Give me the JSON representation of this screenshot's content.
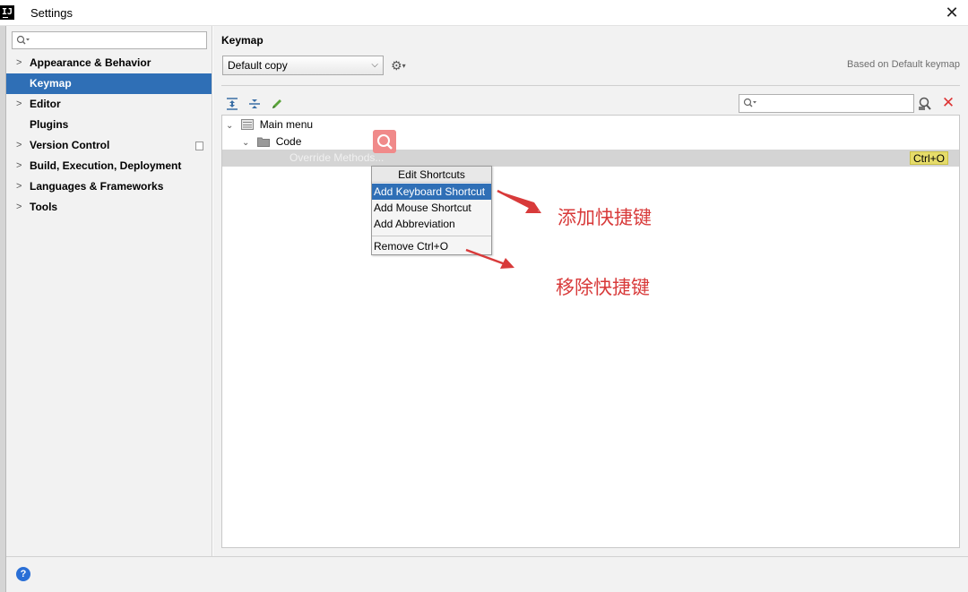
{
  "window": {
    "app_icon": "IJ",
    "title": "Settings",
    "close_glyph": "✕"
  },
  "sidebar": {
    "search_placeholder": "",
    "items": [
      {
        "label": "Appearance & Behavior",
        "expandable": true,
        "selected": false
      },
      {
        "label": "Keymap",
        "expandable": false,
        "selected": true
      },
      {
        "label": "Editor",
        "expandable": true,
        "selected": false
      },
      {
        "label": "Plugins",
        "expandable": false,
        "selected": false
      },
      {
        "label": "Version Control",
        "expandable": true,
        "selected": false
      },
      {
        "label": "Build, Execution, Deployment",
        "expandable": true,
        "selected": false
      },
      {
        "label": "Languages & Frameworks",
        "expandable": true,
        "selected": false
      },
      {
        "label": "Tools",
        "expandable": true,
        "selected": false
      }
    ]
  },
  "main": {
    "title": "Keymap",
    "keymap_selected": "Default copy",
    "based_on": "Based on Default keymap",
    "toolbar_icons": [
      "expand-all-icon",
      "collapse-all-icon",
      "edit-pencil-icon"
    ],
    "search_placeholder": ""
  },
  "tree": {
    "nodes": [
      {
        "label": "Main menu",
        "level": 0,
        "expanded": true
      },
      {
        "label": "Code",
        "level": 1,
        "expanded": true
      }
    ],
    "selected_action": {
      "label": "Override Methods...",
      "shortcut": "Ctrl+O"
    }
  },
  "context_menu": {
    "header": "Edit Shortcuts",
    "items": [
      {
        "label": "Add Keyboard Shortcut",
        "active": true
      },
      {
        "label": "Add Mouse Shortcut",
        "active": false
      },
      {
        "label": "Add Abbreviation",
        "active": false
      }
    ],
    "remove_label": "Remove Ctrl+O"
  },
  "annotations": {
    "add_note": "添加快捷键",
    "remove_note": "移除快捷键",
    "color": "#d83a3a"
  },
  "colors": {
    "selection": "#2f6fb6",
    "shortcut_badge": "#e6dc6a",
    "panel_bg": "#f2f2f2"
  },
  "help": "?"
}
